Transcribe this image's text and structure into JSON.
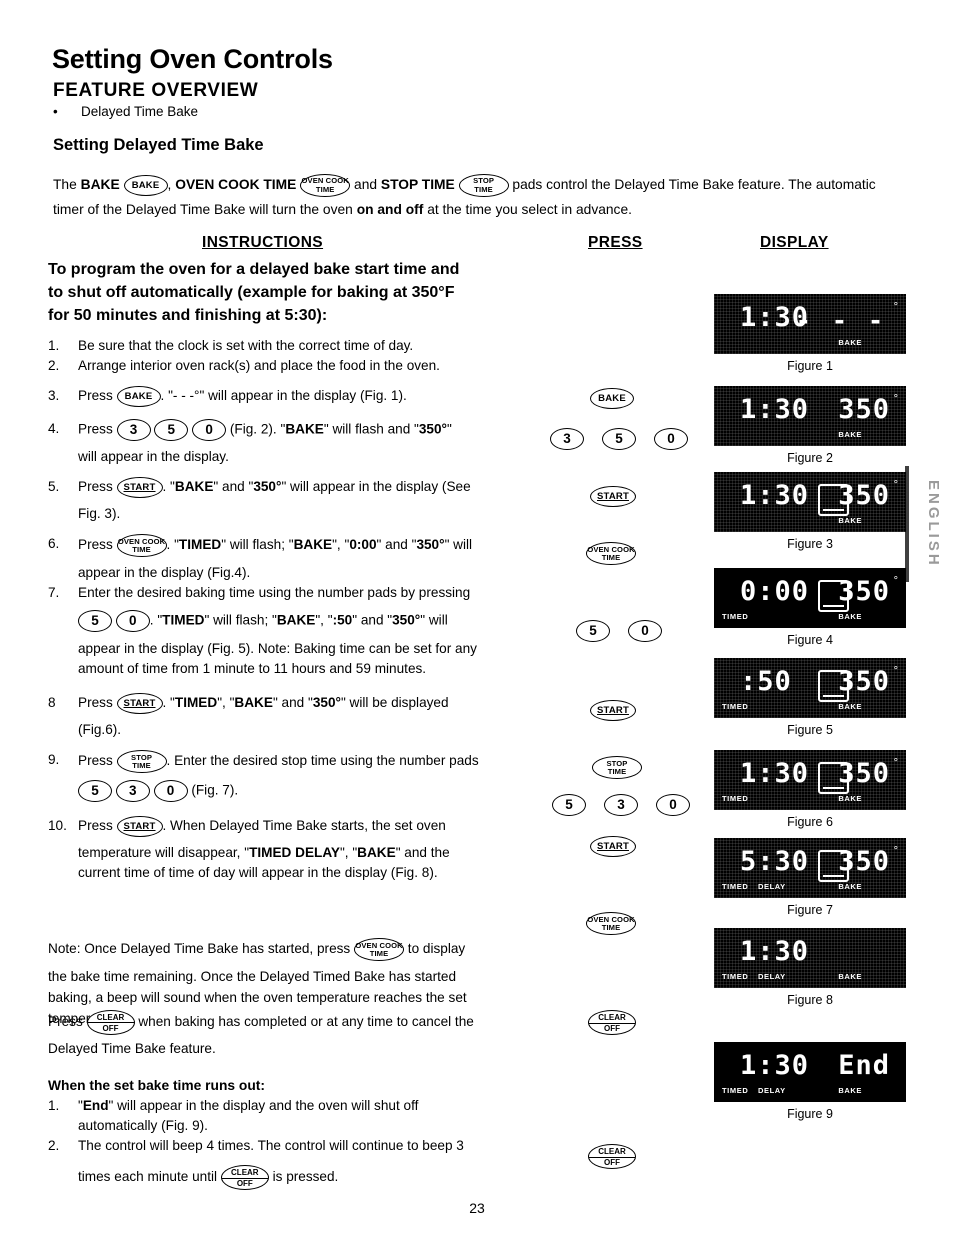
{
  "document": {
    "title": "Setting Oven Controls",
    "section_heading": "FEATURE OVERVIEW",
    "bullet": "Delayed Time Bake",
    "subsection_heading": "Setting Delayed Time Bake",
    "page_number": "23",
    "side_tab": "ENGLISH"
  },
  "intro": {
    "part1": "The ",
    "bake_label": "BAKE",
    "comma": ", ",
    "cook_label": "OVEN COOK TIME",
    "and": " and ",
    "stop_label": "STOP TIME",
    "part2": " pads control the Delayed Time Bake feature. The automatic timer of the Delayed Time Bake will turn the oven ",
    "onoff": "on and off",
    "part3": " at the time you select in advance."
  },
  "columns": {
    "instructions": "INSTRUCTIONS",
    "press": "PRESS",
    "display": "DISPLAY"
  },
  "lead": {
    "line1": "To program the oven for a delayed bake start time and",
    "line2": "to shut off automatically (example for baking at 350°F",
    "line3": "for 50 minutes and finishing at 5:30):"
  },
  "steps": {
    "s1_num": "1.",
    "s1_text": "Be sure that the clock is set with the correct time of day.",
    "s2_num": "2.",
    "s2_text": "Arrange interior oven rack(s) and place the food in the oven.",
    "s3_num": "3.",
    "s3_press": "Press",
    "s3_after": ". \"- - -°\" will appear in the display (Fig. 1).",
    "s4_num": "4.",
    "s4_press": "Press",
    "s4_mid": "(Fig. 2). \"",
    "s4_bake": "BAKE",
    "s4_mid2": "\" will flash and \"",
    "s4_temp": "350°",
    "s4_mid3": "\"",
    "s4_line2": "will appear in the display.",
    "s5_num": "5.",
    "s5_press": "Press",
    "s5_a": ". \"",
    "s5_bake": "BAKE",
    "s5_b": "\" and \"",
    "s5_temp": "350°",
    "s5_c": "\" will appear in the display (See",
    "s5_line2": "Fig. 3).",
    "s6_num": "6.",
    "s6_press": "Press",
    "s6_a": ". \"",
    "s6_timed": "TIMED",
    "s6_b": "\" will flash; \"",
    "s6_bake": "BAKE",
    "s6_c": "\",  \"",
    "s6_zero": "0:00",
    "s6_d": "\"  and \"",
    "s6_temp": "350°",
    "s6_e": "\" will",
    "s6_line2": "appear in the display (Fig.4).",
    "s7_num": "7.",
    "s7_text": "Enter the desired baking time using the number pads by pressing",
    "s7_a": ". \"",
    "s7_timed": "TIMED",
    "s7_b": "\" will flash; \"",
    "s7_bake": "BAKE",
    "s7_c": "\", \"",
    "s7_fifty": ":50",
    "s7_d": "\"  and \"",
    "s7_temp": "350°",
    "s7_e": "\" will",
    "s7_line3": "appear in the display (Fig. 5). Note: Baking time can be set for any",
    "s7_line4": "amount of time from 1 minute to 11 hours and 59 minutes.",
    "s8_num": "8",
    "s8_press": "Press",
    "s8_a": ". \"",
    "s8_timed": "TIMED",
    "s8_b": "\", \"",
    "s8_bake": "BAKE",
    "s8_c": "\" and \"",
    "s8_temp": "350°",
    "s8_d": "\" will be displayed",
    "s8_line2": "(Fig.6).",
    "s9_num": "9.",
    "s9_press": "Press",
    "s9_a": ".  Enter the desired stop time using the number pads",
    "s9_line2_after": "(Fig. 7).",
    "s10_num": "10.",
    "s10_press": "Press",
    "s10_a": ". When Delayed Time Bake starts, the set oven",
    "s10_line2a": "temperature will disappear, \"",
    "s10_timed_delay": "TIMED DELAY",
    "s10_line2b": "\", \"",
    "s10_bake": "BAKE",
    "s10_line2c": "\" and the",
    "s10_line3": "current time of time of day will appear in the display (Fig. 8)."
  },
  "note": {
    "lead": "Note: Once Delayed Time Bake has started, press",
    "after": "to display",
    "line2": "the bake time remaining. Once the Delayed Timed Bake has started",
    "line3": "baking, a beep will sound when the oven temperature reaches the set",
    "line4": "temperature."
  },
  "cancel": {
    "press": "Press",
    "after": "when baking has completed or at any time to cancel the",
    "line2": "Delayed Time Bake feature."
  },
  "runsout": {
    "heading": "When the set bake time runs out:",
    "i1_num": "1.",
    "i1_a": "\"",
    "i1_end": "End",
    "i1_b": "\" will appear in the display and the oven will shut off",
    "i1_line2": "automatically (Fig. 9).",
    "i2_num": "2.",
    "i2_text": "The control will beep 4 times. The control will  continue to beep 3",
    "i2_line2a": "times each minute until",
    "i2_line2b": "is pressed."
  },
  "pads": {
    "bake": "BAKE",
    "start": "START",
    "oven_cook_l1": "OVEN COOK",
    "oven_cook_l2": "TIME",
    "stop_l1": "STOP",
    "stop_l2": "TIME",
    "clear_l1": "CLEAR",
    "clear_l2": "OFF",
    "n0": "0",
    "n3": "3",
    "n5": "5"
  },
  "press_column": {
    "b1": "BAKE",
    "b2_1": "3",
    "b2_2": "5",
    "b2_3": "0",
    "b3": "START",
    "b4_l1": "OVEN COOK",
    "b4_l2": "TIME",
    "b5_1": "5",
    "b5_2": "0",
    "b6": "START",
    "b7_l1": "STOP",
    "b7_l2": "TIME",
    "b8_1": "5",
    "b8_2": "3",
    "b8_3": "0",
    "b9": "START",
    "b10_l1": "OVEN COOK",
    "b10_l2": "TIME",
    "b11_l1": "CLEAR",
    "b11_l2": "OFF",
    "b12_l1": "CLEAR",
    "b12_l2": "OFF"
  },
  "figures": [
    {
      "caption": "Figure 1",
      "left": "1:30",
      "right": "- - -",
      "degree": true,
      "box": false,
      "timed": "",
      "delay": "",
      "bake": "BAKE",
      "bake_pos": "left",
      "dither": true
    },
    {
      "caption": "Figure 2",
      "left": "1:30",
      "right": "350",
      "degree": true,
      "box": false,
      "timed": "",
      "delay": "",
      "bake": "BAKE",
      "bake_pos": "left",
      "dither": true
    },
    {
      "caption": "Figure 3",
      "left": "1:30",
      "right": "350",
      "degree": true,
      "box": true,
      "timed": "",
      "delay": "",
      "bake": "BAKE",
      "bake_pos": "left",
      "dither": true
    },
    {
      "caption": "Figure 4",
      "left": "0:00",
      "right": "350",
      "degree": true,
      "box": true,
      "timed": "TIMED",
      "delay": "",
      "bake": "BAKE",
      "bake_pos": "left",
      "dither": false
    },
    {
      "caption": "Figure 5",
      "left": ":50",
      "right": "350",
      "degree": true,
      "box": true,
      "timed": "TIMED",
      "delay": "",
      "bake": "BAKE",
      "bake_pos": "left",
      "dither": true
    },
    {
      "caption": "Figure 6",
      "left": "1:30",
      "right": "350",
      "degree": true,
      "box": true,
      "timed": "TIMED",
      "delay": "",
      "bake": "BAKE",
      "bake_pos": "left",
      "dither": true
    },
    {
      "caption": "Figure 7",
      "left": "5:30",
      "right": "350",
      "degree": true,
      "box": true,
      "timed": "TIMED",
      "delay": "DELAY",
      "bake": "BAKE",
      "bake_pos": "left",
      "dither": true
    },
    {
      "caption": "Figure 8",
      "left": "1:30",
      "right": "",
      "degree": false,
      "box": false,
      "timed": "TIMED",
      "delay": "DELAY",
      "bake": "BAKE",
      "bake_pos": "left",
      "dither": true
    },
    {
      "caption": "Figure 9",
      "left": "1:30",
      "right": "End",
      "degree": false,
      "box": false,
      "timed": "TIMED",
      "delay": "DELAY",
      "bake": "BAKE",
      "bake_pos": "left",
      "dither": false
    }
  ],
  "colors": {
    "page_bg": "#ffffff",
    "ink": "#000000",
    "lcd_bg": "#000000",
    "lcd_fg": "#ffffff",
    "side_tab": "#9a9a9a"
  }
}
